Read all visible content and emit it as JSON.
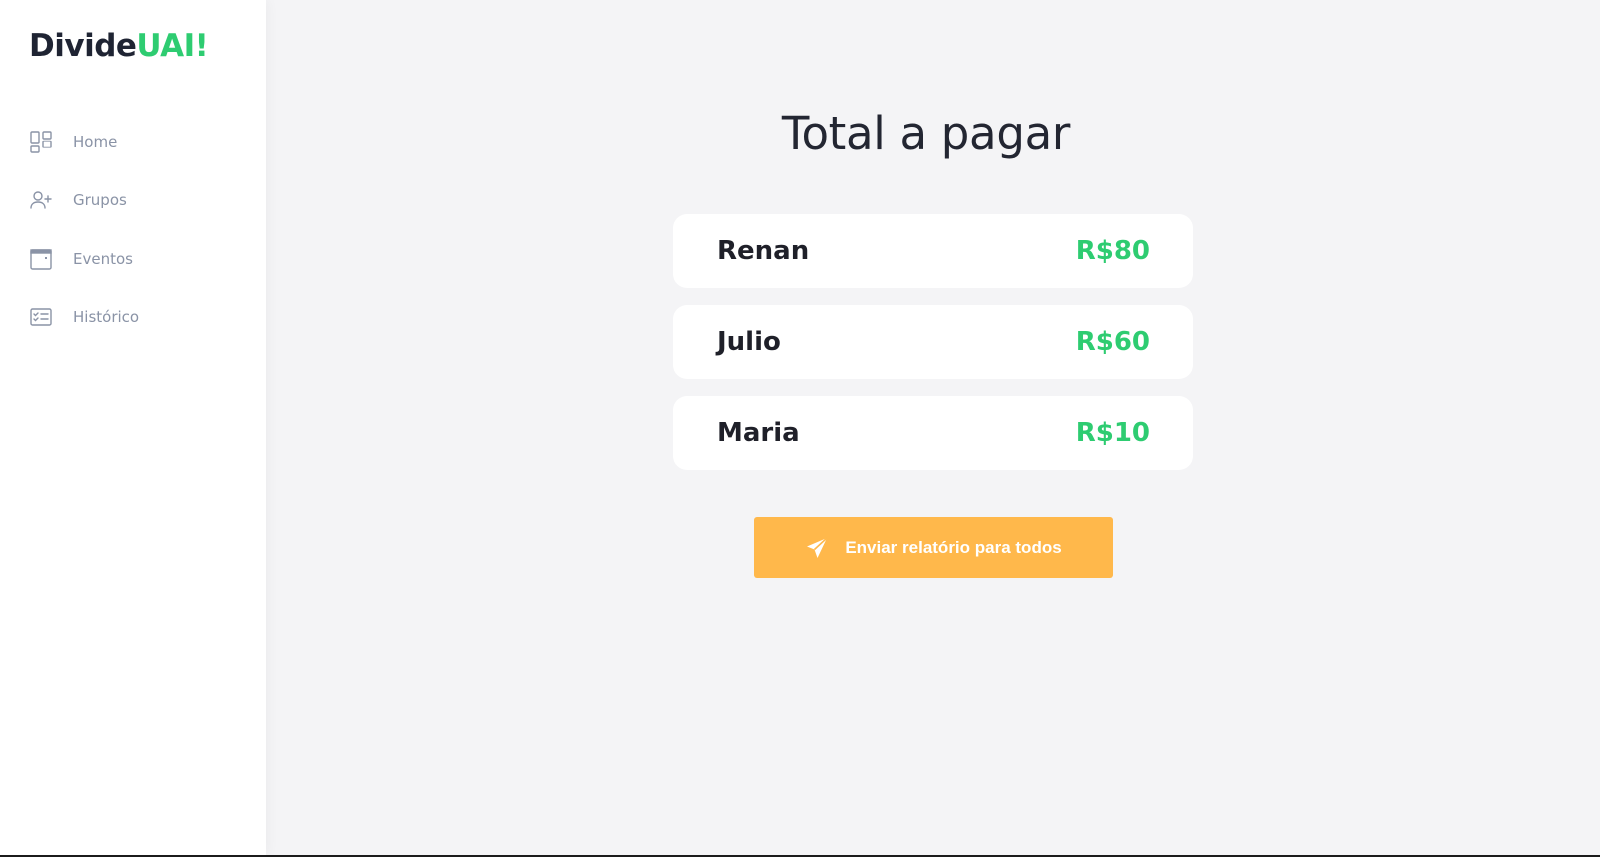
{
  "app": {
    "logo_part1": "Divide",
    "logo_part2": "UAI!"
  },
  "sidebar": {
    "items": [
      {
        "label": "Home",
        "icon": "dashboard-icon"
      },
      {
        "label": "Grupos",
        "icon": "add-user-icon"
      },
      {
        "label": "Eventos",
        "icon": "calendar-icon"
      },
      {
        "label": "Histórico",
        "icon": "checklist-icon"
      }
    ]
  },
  "main": {
    "title": "Total a pagar",
    "payments": [
      {
        "name": "Renan",
        "amount": "R$80"
      },
      {
        "name": "Julio",
        "amount": "R$60"
      },
      {
        "name": "Maria",
        "amount": "R$10"
      }
    ],
    "send_button": {
      "label": "Enviar relatório para todos",
      "icon": "send-icon"
    }
  },
  "colors": {
    "accent_green": "#2ecc71",
    "button_orange": "#ffb84b",
    "background": "#f4f4f6",
    "sidebar_text": "#8a93a6"
  }
}
